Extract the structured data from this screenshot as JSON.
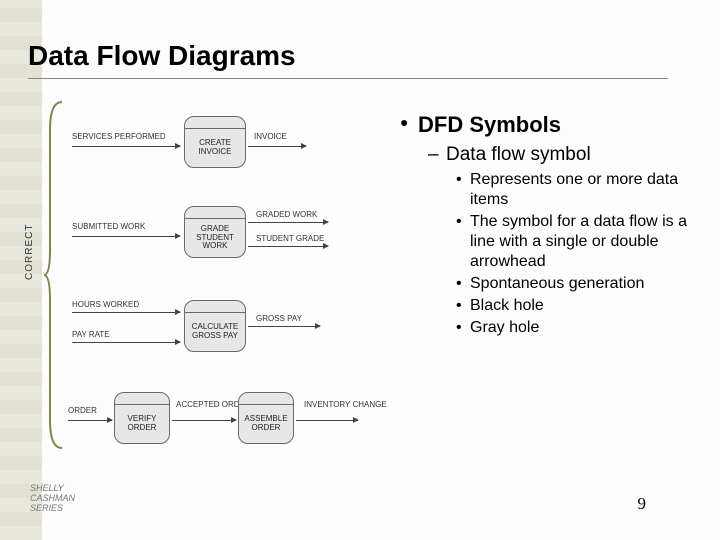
{
  "title": "Data Flow Diagrams",
  "correct_label": "CORRECT",
  "rows": {
    "r1": {
      "in": "SERVICES PERFORMED",
      "proc": "CREATE INVOICE",
      "out": "INVOICE"
    },
    "r2": {
      "in": "SUBMITTED WORK",
      "proc": "GRADE STUDENT WORK",
      "out1": "GRADED WORK",
      "out2": "STUDENT GRADE"
    },
    "r3": {
      "in1": "HOURS WORKED",
      "in2": "PAY RATE",
      "proc": "CALCULATE GROSS PAY",
      "out": "GROSS PAY"
    },
    "r4": {
      "in": "ORDER",
      "proc1": "VERIFY ORDER",
      "mid": "ACCEPTED ORDER",
      "proc2": "ASSEMBLE ORDER",
      "out": "INVENTORY CHANGE"
    }
  },
  "content": {
    "main": "DFD Symbols",
    "sub": "Data flow symbol",
    "items": [
      "Represents one or more data items",
      "The symbol for a data flow is a line with a single or double arrowhead",
      "Spontaneous generation",
      "Black hole",
      "Gray hole"
    ]
  },
  "footer": {
    "page": "9",
    "logo_lines": [
      "SHELLY",
      "CASHMAN",
      "SERIES"
    ]
  }
}
